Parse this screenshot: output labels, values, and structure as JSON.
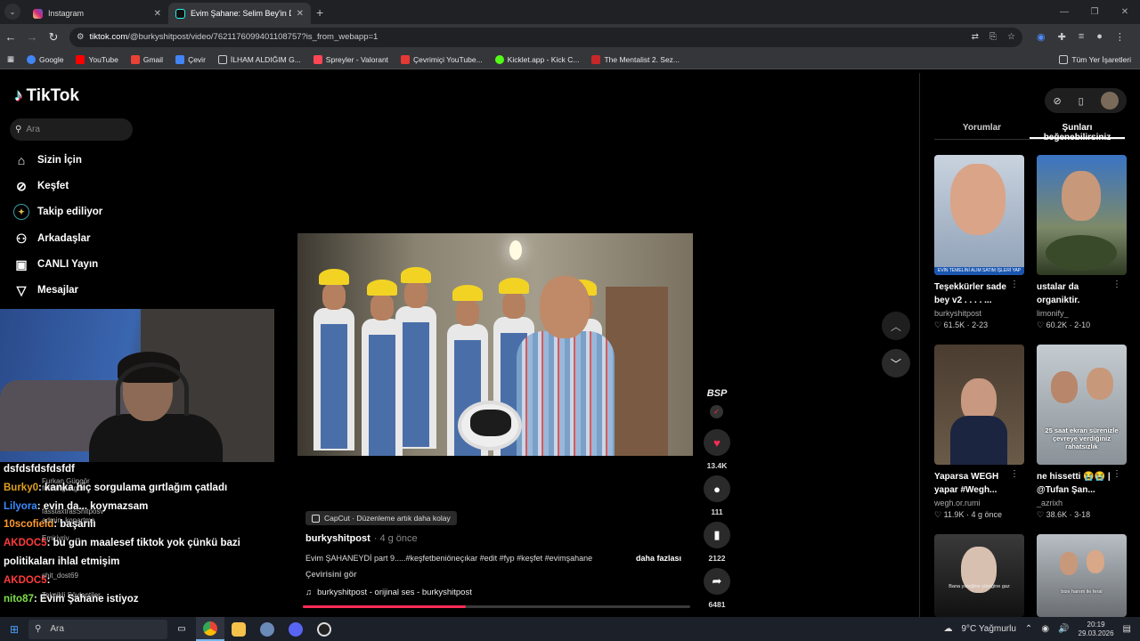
{
  "browser": {
    "tabs": [
      {
        "title": "Instagram",
        "icon": "instagram-icon",
        "color": "#d6249f"
      },
      {
        "title": "Evim Şahane: Selim Bey'in Döni",
        "icon": "tiktok-icon",
        "color": "#111111"
      }
    ],
    "url_host": "tiktok.com",
    "url_path": "/@burkyshitpost/video/7621176099401108757?is_from_webapp=1",
    "bookmarks": [
      {
        "label": "Google",
        "color": "#4285f4"
      },
      {
        "label": "YouTube",
        "color": "#ff0000"
      },
      {
        "label": "Gmail",
        "color": "#ea4335"
      },
      {
        "label": "Çevir",
        "color": "#4285f4"
      },
      {
        "label": "İLHAM ALDIĞIM G...",
        "color": "#cccccc"
      },
      {
        "label": "Spreyler - Valorant",
        "color": "#ff4655"
      },
      {
        "label": "Çevrimiçi YouTube...",
        "color": "#e53935"
      },
      {
        "label": "Kicklet.app - Kick C...",
        "color": "#53fc18"
      },
      {
        "label": "The Mentalist 2. Sez...",
        "color": "#c62828"
      }
    ],
    "bookmarks_all": "Tüm Yer İşaretleri"
  },
  "sidebar": {
    "logo": "TikTok",
    "search_placeholder": "Ara",
    "items": [
      {
        "label": "Sizin İçin",
        "icon": "home-icon"
      },
      {
        "label": "Keşfet",
        "icon": "compass-icon"
      },
      {
        "label": "Takip ediliyor",
        "icon": "following-icon"
      },
      {
        "label": "Arkadaşlar",
        "icon": "friends-icon"
      },
      {
        "label": "CANLI Yayın",
        "icon": "live-icon"
      },
      {
        "label": "Mesajlar",
        "icon": "message-icon"
      }
    ]
  },
  "chat": [
    {
      "user": "dsfdsfdsfdsfdf",
      "msg": "",
      "color": "#ffffff"
    },
    {
      "user": "Burky0",
      "msg": ": kanka hiç sorgulama gırtlağım çatladı",
      "color": "#e0a020"
    },
    {
      "user": "Lilyora",
      "msg": ": evin da... koymazsam",
      "color": "#3a8cff"
    },
    {
      "user": "10scofield",
      "msg": ": başarılı",
      "color": "#ff9a2a"
    },
    {
      "user": "AKDOC5",
      "msg": ": bu gün maalesef tiktok yok çünkü bazi",
      "color": "#ff3b3b"
    },
    {
      "user": "",
      "msg": "politikaları ihlal etmişim",
      "color": "#ffffff"
    },
    {
      "user": "AKDOC5",
      "msg": ":",
      "color": "#ff3b3b"
    },
    {
      "user": "nito87",
      "msg": ": Evim Şahane istiyoz",
      "color": "#7ee04a"
    }
  ],
  "chat_ghost": [
    "Furkan Güngör",
    "furkangungor",
    "fasstaxtrasShitposv",
    "admin_kopartma",
    "Emirivriv",
    "shit_dost69",
    "Teknikli Söylentiler"
  ],
  "video": {
    "capcut_label": "CapCut · Düzenleme artık daha kolay",
    "author": "burkyshitpost",
    "ago": "· 4 g önce",
    "description": "Evim ŞAHANEYDİ part 9.....#keşfetbeniöneçıkar #edit #fyp #keşfet #evimşahane",
    "more": "daha fazlası",
    "translate": "Çevirisini gör",
    "music": "burkyshitpost - orijinal ses - burkyshitpost",
    "progress": 0.42,
    "creator_badge": "BSP",
    "likes": "13.4K",
    "comments": "111",
    "saves": "2122",
    "shares": "6481"
  },
  "right_panel": {
    "tabs": [
      "Yorumlar",
      "Şunları beğenebilirsiniz"
    ],
    "active_tab": 1,
    "cards": [
      {
        "title": "Teşekkürler sade bey v2 . . . . ...",
        "user": "burkyshitpost",
        "likes": "61.5K",
        "age": "2-23",
        "overlay": "EVİN TEMELİNİ ALIM SATIM İŞLERİ YAP",
        "bg": "#7d8ea8"
      },
      {
        "title": "ustalar da organiktir.",
        "user": "limonify_",
        "likes": "60.2K",
        "age": "2-10",
        "overlay": "",
        "bg": "#8a7f72"
      },
      {
        "title": "Yaparsa WEGH yapar #Wegh...",
        "user": "wegh.or.rumi",
        "likes": "11.9K",
        "age": "4 g önce",
        "overlay": "",
        "bg": "#5a4a3a"
      },
      {
        "title": "ne hissetti 😭😭 | @Tufan Şan...",
        "user": "_azrixh",
        "likes": "38.6K",
        "age": "3-18",
        "overlay": "25 saat ekran sürenizle çevreye verdiğiniz rahatsızlık",
        "bg": "#9aa3a8"
      },
      {
        "title": "",
        "user": "",
        "likes": "",
        "age": "",
        "overlay": "Bana yüreğine yüreğine gaz",
        "bg": "#2a2a2a"
      },
      {
        "title": "",
        "user": "",
        "likes": "",
        "age": "",
        "overlay": "bize hanım ile feral",
        "bg": "#8a8f96"
      }
    ]
  },
  "taskbar": {
    "search": "Ara",
    "weather": "9°C  Yağmurlu",
    "time": "20:19",
    "date": "29.03.2026"
  }
}
